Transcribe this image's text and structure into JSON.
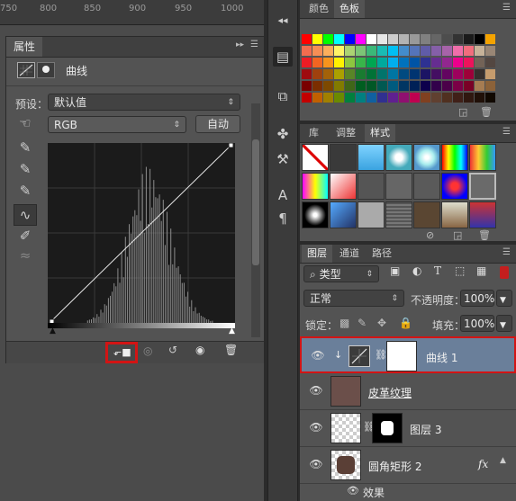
{
  "ruler": {
    "ticks": [
      "750",
      "800",
      "850",
      "900",
      "950",
      "1000"
    ]
  },
  "properties": {
    "tab_label": "属性",
    "adjustment_title": "曲线",
    "preset_label": "预设：",
    "preset_value": "默认值",
    "channel_value": "RGB",
    "auto_button": "自动"
  },
  "swatches_panel": {
    "tabs": [
      "颜色",
      "色板"
    ],
    "active_tab": "色板"
  },
  "styles_panel": {
    "tabs": [
      "库",
      "调整",
      "样式"
    ],
    "active_tab": "样式"
  },
  "layers_panel": {
    "tabs": [
      "图层",
      "通道",
      "路径"
    ],
    "active_tab": "图层",
    "filter_kind": "类型",
    "blend_mode": "正常",
    "opacity_label": "不透明度：",
    "opacity_value": "100%",
    "lock_label": "锁定：",
    "fill_label": "填充：",
    "fill_value": "100%",
    "layers": [
      {
        "name": "曲线 1",
        "selected": true
      },
      {
        "name": "皮革纹理"
      },
      {
        "name": "图层 3"
      },
      {
        "name": "圆角矩形 2",
        "fx": "fx"
      }
    ],
    "effects_label": "效果"
  },
  "colors": {
    "highlight": "#d21414",
    "selected_row": "#6a7f9a"
  }
}
